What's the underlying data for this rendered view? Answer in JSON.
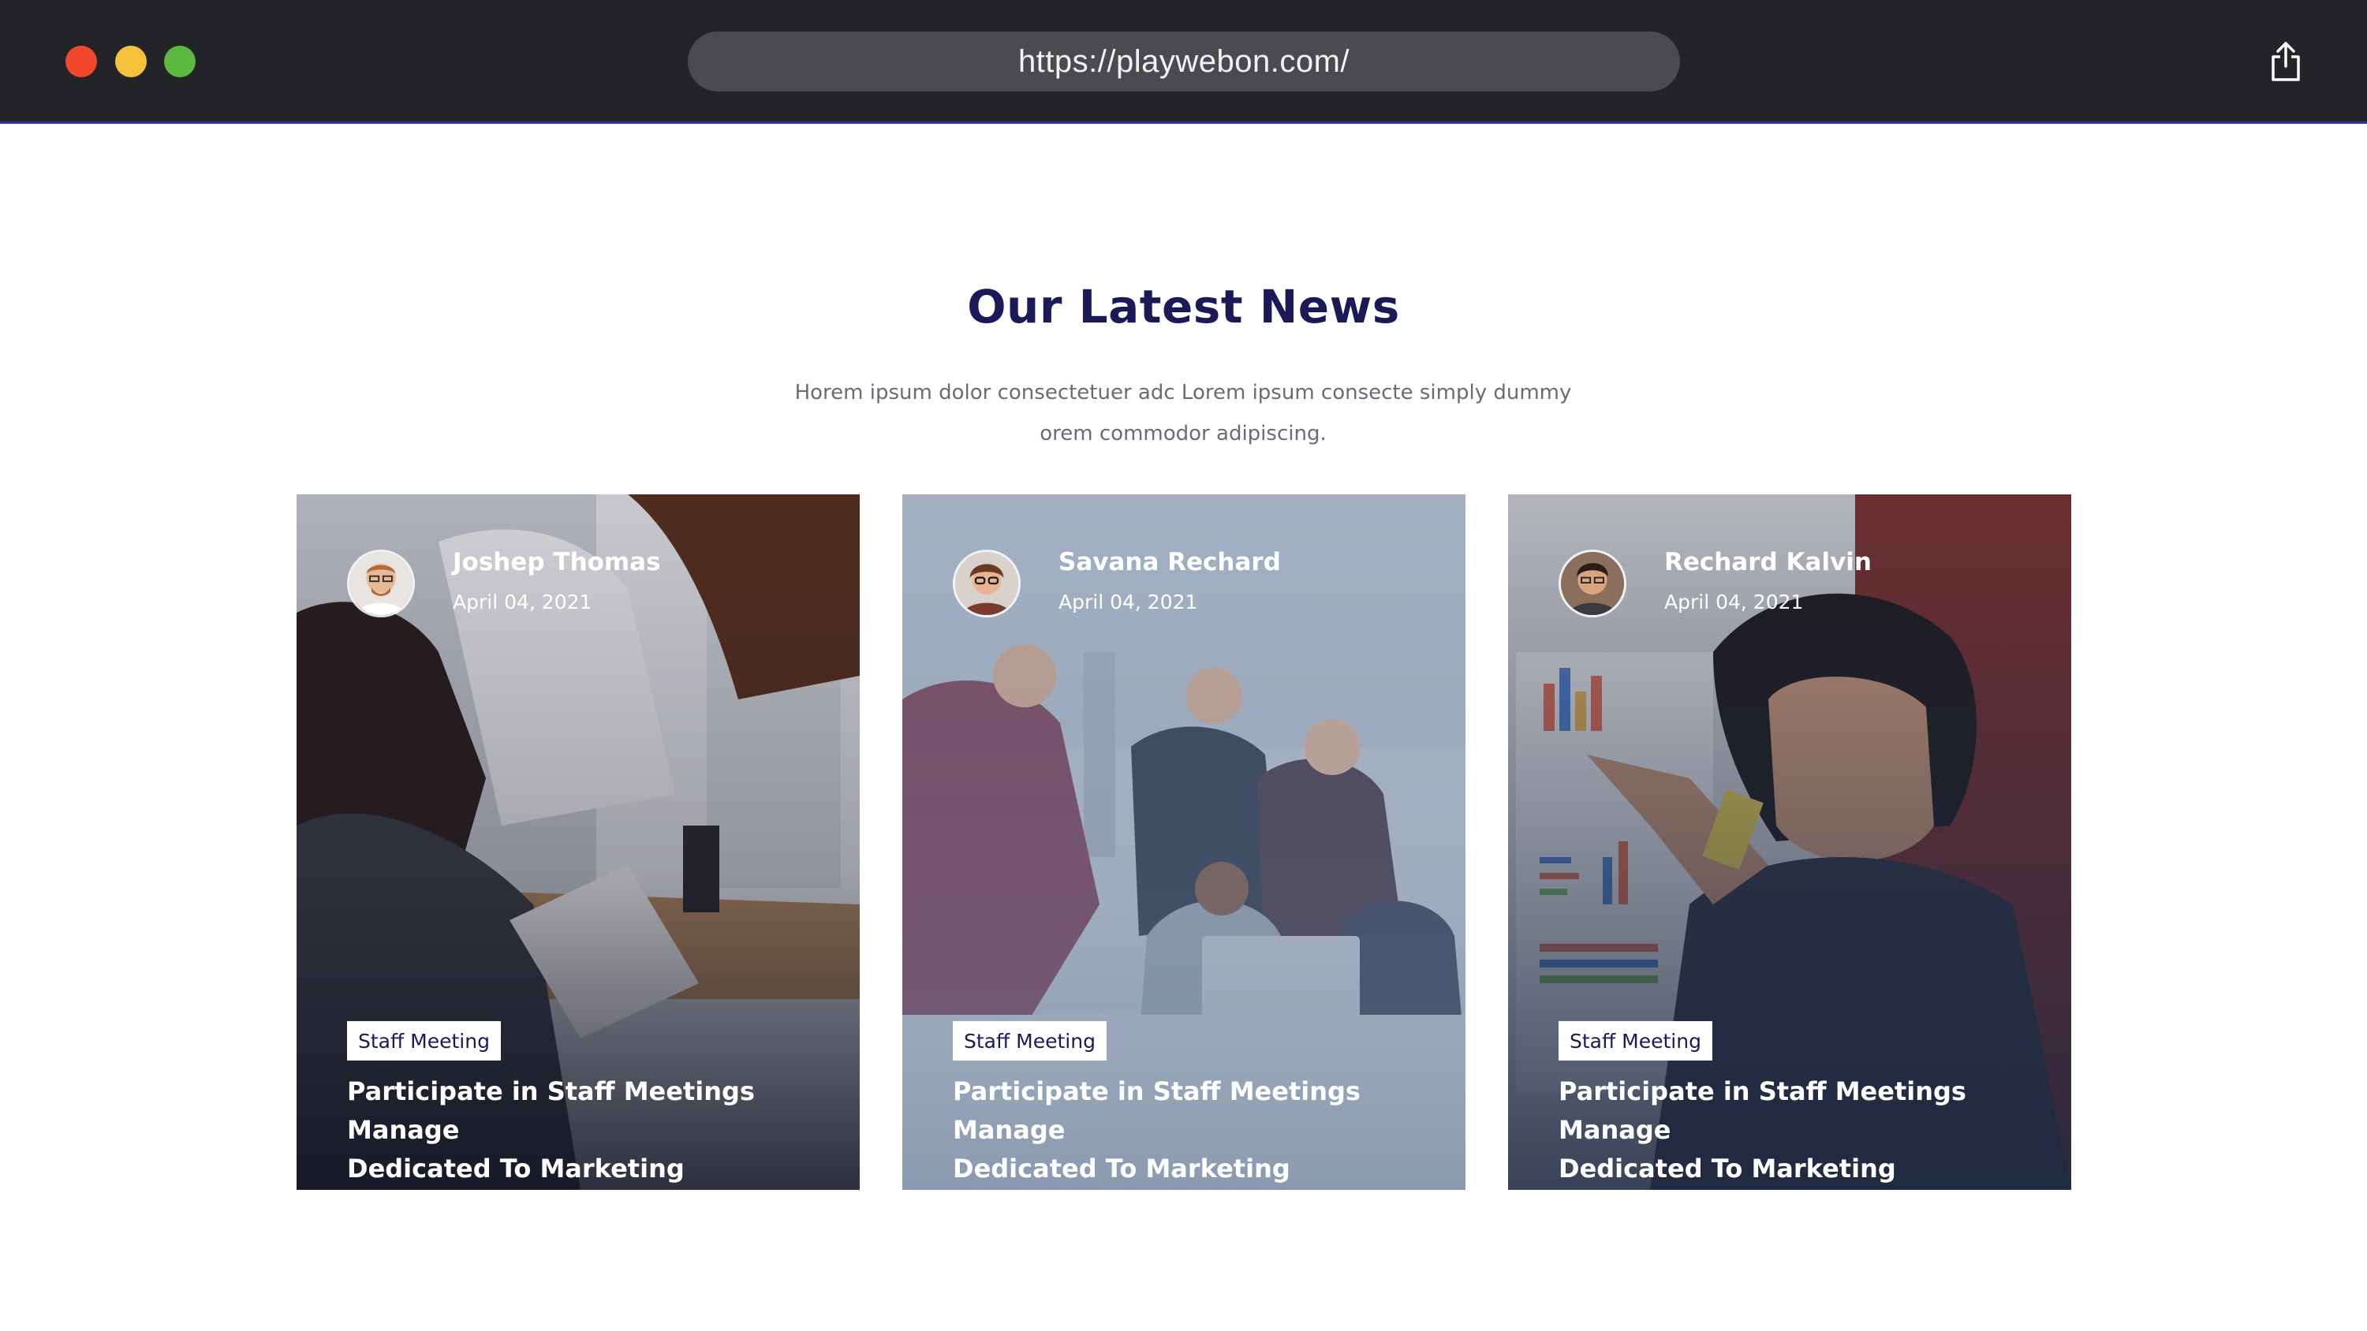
{
  "browser": {
    "url": "https://playwebon.com/",
    "traffic_lights": {
      "close_color": "#f0472f",
      "minimize_color": "#f5c33b",
      "zoom_color": "#5cb83e"
    }
  },
  "section": {
    "title": "Our Latest News",
    "subtitle_line1": "Horem ipsum dolor consectetuer adc Lorem ipsum consecte simply dummy",
    "subtitle_line2": "orem commodor adipiscing."
  },
  "cards": [
    {
      "author": "Joshep Thomas",
      "date": "April 04, 2021",
      "tag": "Staff Meeting",
      "headline_line1": "Participate in Staff Meetings Manage",
      "headline_line2": "Dedicated To Marketing"
    },
    {
      "author": "Savana Rechard",
      "date": "April 04, 2021",
      "tag": "Staff Meeting",
      "headline_line1": "Participate in Staff Meetings Manage",
      "headline_line2": "Dedicated To Marketing"
    },
    {
      "author": "Rechard Kalvin",
      "date": "April 04, 2021",
      "tag": "Staff Meeting",
      "headline_line1": "Participate in Staff Meetings Manage",
      "headline_line2": "Dedicated To Marketing"
    }
  ],
  "colors": {
    "title": "#1c1a56",
    "subtitle": "#6b6b76",
    "chrome_bg": "#232427",
    "urlbar_bg": "#4a4b4f"
  }
}
